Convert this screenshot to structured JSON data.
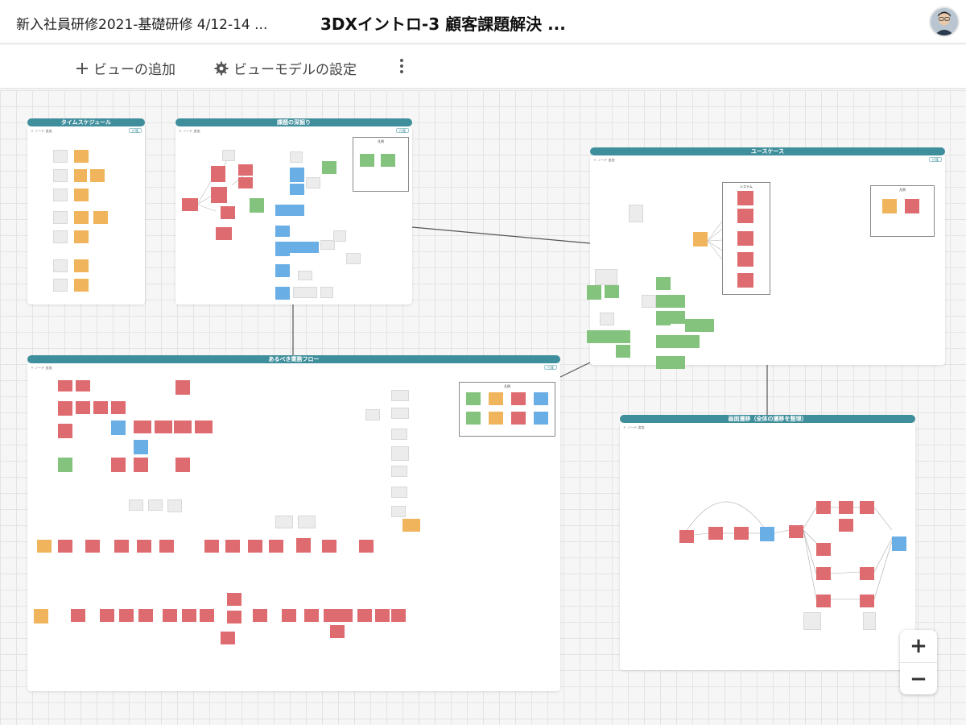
{
  "header": {
    "breadcrumb": "新入社員研修2021-基礎研修 4/12-14 ...",
    "title": "3DXイントロ-3 顧客課題解決 ..."
  },
  "toolbar": {
    "add_view": "ビューの追加",
    "view_model_settings": "ビューモデルの設定"
  },
  "panels": {
    "schedule": {
      "title": "タイムスケジュール"
    },
    "issues": {
      "title": "課題の深掘り",
      "legend": "凡例"
    },
    "usecase": {
      "title": "ユースケース",
      "system": "システム",
      "legend": "凡例"
    },
    "flow": {
      "title": "あるべき業務フロー",
      "legend": "凡例"
    },
    "screen": {
      "title": "画面遷移（全体の遷移を整理）"
    }
  },
  "colors": {
    "header_bar": "#3f8e9c",
    "note_orange": "#f0b45c",
    "note_red": "#de6b6f",
    "note_blue": "#6aaee6",
    "note_green": "#84c37d"
  },
  "icons": {
    "add": "plus-icon",
    "settings": "gear-icon",
    "more": "more-vertical-icon"
  },
  "zoom": {
    "in": "+",
    "out": "−"
  }
}
